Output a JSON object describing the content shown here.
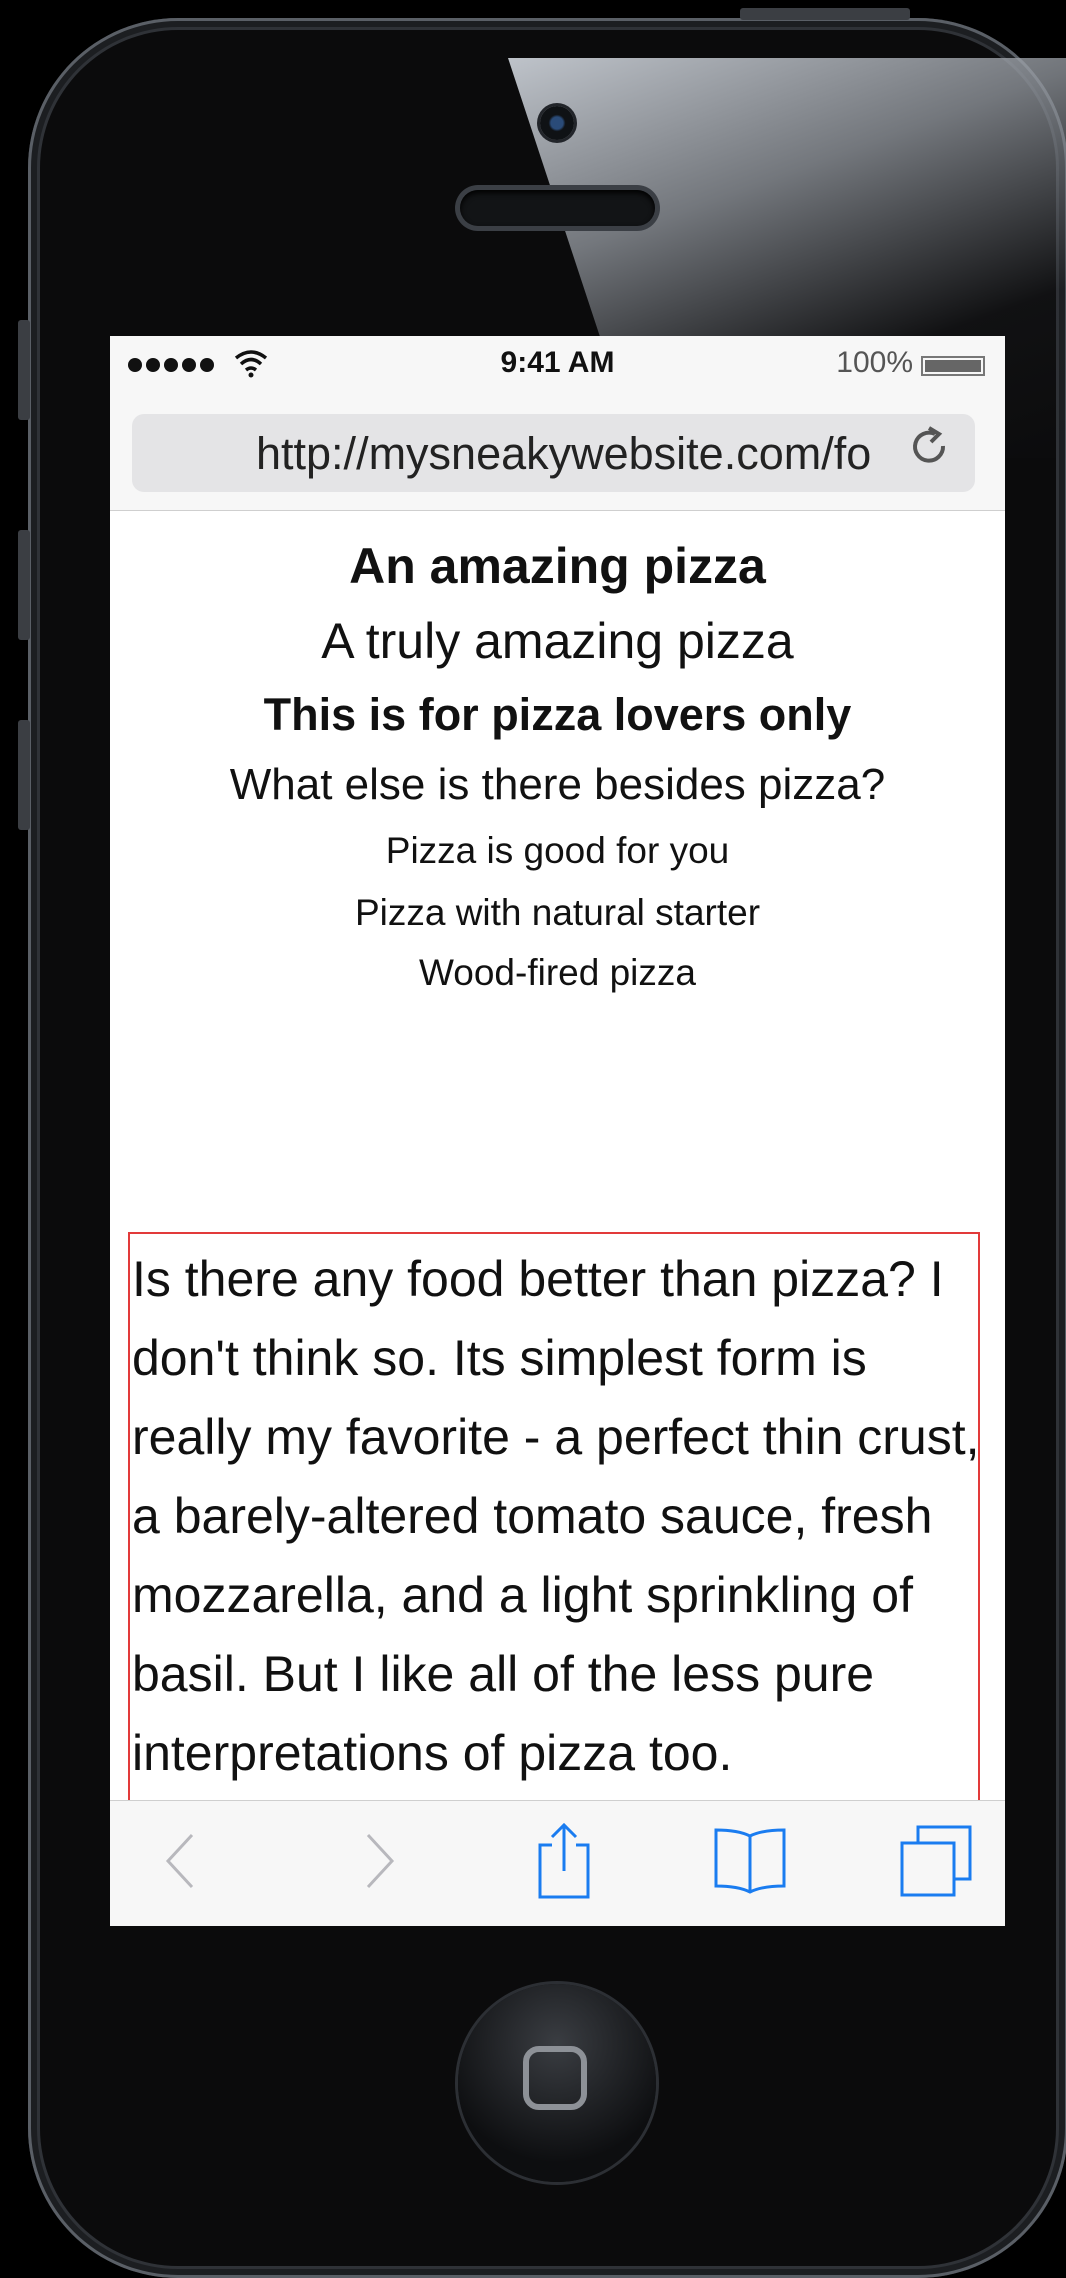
{
  "status_bar": {
    "time": "9:41 AM",
    "battery": "100%",
    "battery_level": 1.0,
    "signal_bars": 5
  },
  "browser": {
    "url": "http://mysneakywebsite.com/fo"
  },
  "page": {
    "headings": [
      "An amazing pizza",
      "A truly amazing pizza",
      "This is for pizza lovers only",
      "What else is there besides pizza?",
      "Pizza is good for you",
      "Pizza with natural starter",
      "Wood-fired pizza"
    ],
    "paragraph": "Is there any food better than pizza? I don't think so. Its simplest form is really my favorite - a perfect thin crust, a barely-altered tomato sauce, fresh mozzarella, and a light sprinkling of basil. But I like all of the less pure interpretations of pizza too.",
    "highlight_color": "#e23a3a"
  },
  "toolbar": {
    "icons": [
      "back-icon",
      "forward-icon",
      "share-icon",
      "bookmarks-icon",
      "tabs-icon"
    ],
    "accent_color": "#1a7cf0",
    "disabled_color": "#b8b8bd"
  }
}
